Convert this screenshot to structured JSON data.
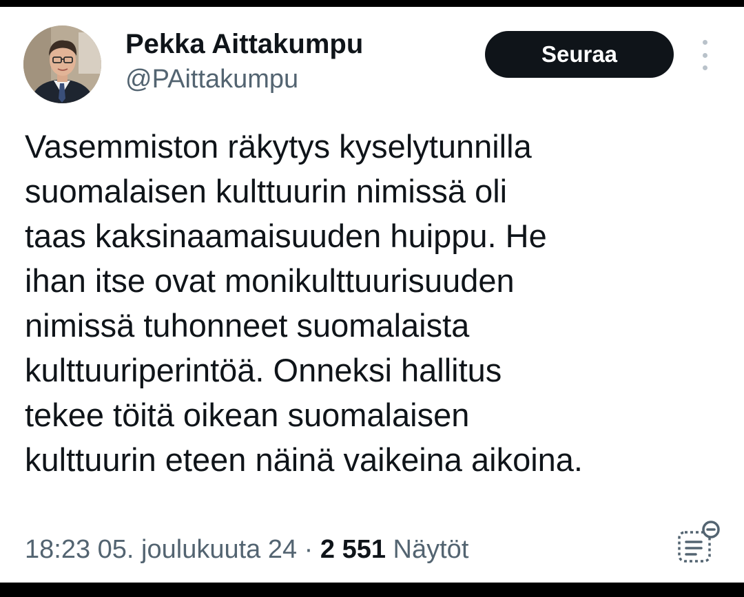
{
  "author": {
    "display_name": "Pekka Aittakumpu",
    "handle": "@PAittakumpu",
    "avatar_icon": "profile-photo"
  },
  "actions": {
    "follow_label": "Seuraa",
    "more_icon": "vertical-ellipsis-icon"
  },
  "tweet": {
    "lines": [
      "Vasemmiston räkytys kyselytunnilla",
      "suomalaisen kulttuurin nimissä oli",
      "taas kaksinaamaisuuden huippu. He",
      "ihan itse ovat monikulttuurisuuden",
      "nimissä tuhonneet suomalaista",
      "kulttuuriperintöä. Onneksi hallitus",
      "tekee töitä oikean suomalaisen",
      "kulttuurin eteen näinä vaikeina aikoina."
    ]
  },
  "meta": {
    "time": "18:23",
    "date": "05. joulukuuta 24",
    "separator": "·",
    "views_count": "2 551",
    "views_label": "Näytöt",
    "analytics_icon": "post-analytics-icon"
  },
  "colors": {
    "text_primary": "#0f1419",
    "text_secondary": "#536471",
    "button_bg": "#0f1419",
    "button_text": "#ffffff",
    "background": "#ffffff"
  }
}
